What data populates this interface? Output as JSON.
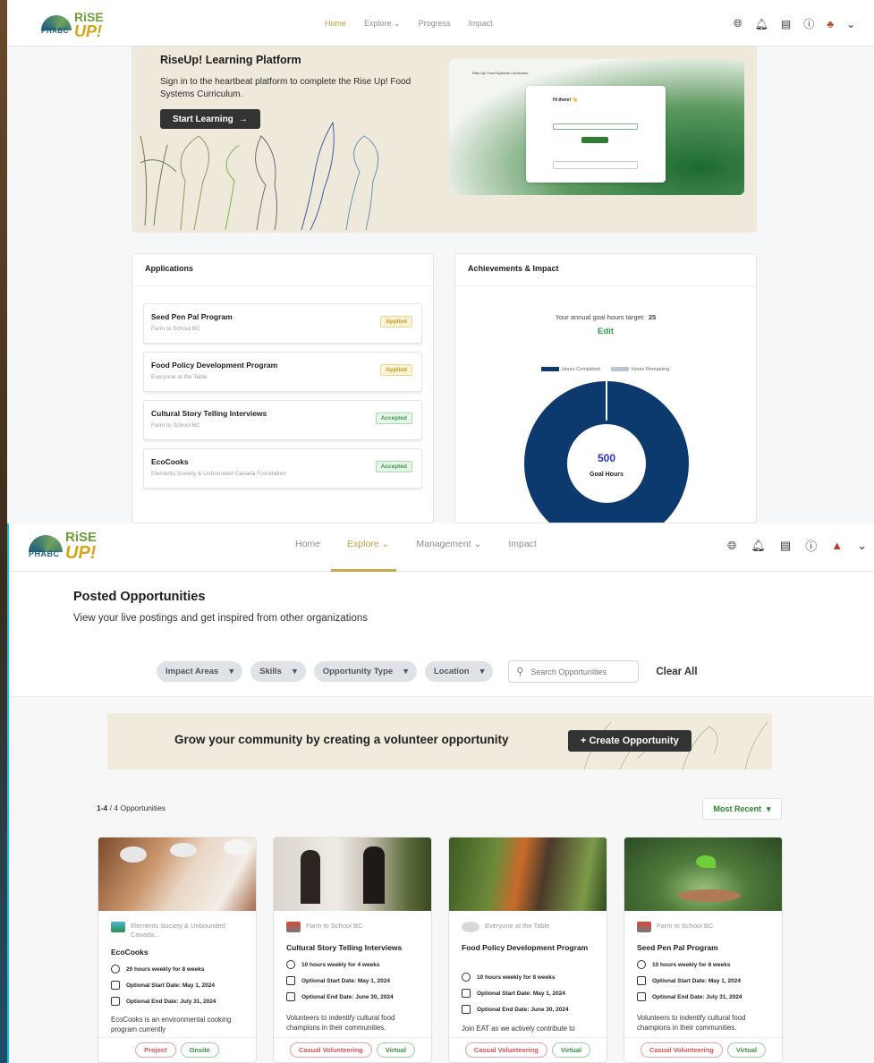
{
  "top": {
    "nav": {
      "brand_org": "PHABC",
      "brand_rise": "RiSE",
      "brand_up": "UP!",
      "menu": [
        "Home",
        "Explore",
        "Progress",
        "Impact"
      ]
    },
    "hero": {
      "title": "RiseUp! Learning Platform",
      "text": "Sign in to the heartbeat platform to complete the Rise Up! Food Systems Curriculum.",
      "button": "Start Learning",
      "preview_title": "Rise Up! Food Systems Curriculum",
      "preview_greeting": "Hi there! 👋"
    },
    "applications": {
      "title": "Applications",
      "items": [
        {
          "title": "Seed Pen Pal Program",
          "org": "Farm to School BC",
          "status": "Applied"
        },
        {
          "title": "Food Policy Development Program",
          "org": "Everyone at the Table",
          "status": "Applied"
        },
        {
          "title": "Cultural Story Telling Interviews",
          "org": "Farm to School BC",
          "status": "Accepted"
        },
        {
          "title": "EcoCooks",
          "org": "Elements Society & Unbounded Canada Foundation",
          "status": "Accepted"
        }
      ]
    },
    "achievements": {
      "title": "Achievements & Impact",
      "target_label": "Your annual goal hours target:",
      "target_value": "25",
      "edit": "Edit",
      "legend_completed": "Hours Completed",
      "legend_remaining": "Hours Remaining",
      "goal_value": "500",
      "goal_label": "Goal Hours",
      "completed_fraction": 0.0
    }
  },
  "bottom": {
    "nav": {
      "brand_org": "PHABC",
      "brand_rise": "RiSE",
      "brand_up": "UP!",
      "menu": [
        "Home",
        "Explore",
        "Management",
        "Impact"
      ]
    },
    "page_title": "Posted Opportunities",
    "page_subtitle": "View your live postings and get inspired from other organizations",
    "filters": [
      "Impact Areas",
      "Skills",
      "Opportunity Type",
      "Location"
    ],
    "search_placeholder": "Search Opportunities",
    "clear_all": "Clear All",
    "banner_text": "Grow your community by creating a volunteer opportunity",
    "banner_button": "+ Create Opportunity",
    "count_range": "1-4",
    "count_total": "/ 4 Opportunities",
    "sort": "Most Recent",
    "cards": [
      {
        "org": "Elements Society & Unbounded Canada...",
        "title": "EcoCooks",
        "hours": "20 hours weekly for 8 weeks",
        "start": "Optional Start Date: May 1, 2024",
        "end": "Optional End Date: July 31, 2024",
        "desc": "EcoCooks is an environmental cooking program currently",
        "tags": [
          "Project",
          "Onsite"
        ]
      },
      {
        "org": "Farm to School BC",
        "title": "Cultural Story Telling Interviews",
        "hours": "10 hours weekly for 4 weeks",
        "start": "Optional Start Date: May 1, 2024",
        "end": "Optional End Date: June 30, 2024",
        "desc": "Volunteers to indentify cultural food champions in their communities.",
        "tags": [
          "Casual Volunteering",
          "Virtual"
        ]
      },
      {
        "org": "Everyone at the Table",
        "title": "Food Policy Development Program",
        "hours": "10 hours weekly for 8 weeks",
        "start": "Optional Start Date: May 1, 2024",
        "end": "Optional End Date: June 30, 2024",
        "desc": "Join EAT as we actively contribute to",
        "tags": [
          "Casual Volunteering",
          "Virtual"
        ]
      },
      {
        "org": "Farm to School BC",
        "title": "Seed Pen Pal Program",
        "hours": "10 hours weekly for 8 weeks",
        "start": "Optional Start Date: May 1, 2024",
        "end": "Optional End Date: July 31, 2024",
        "desc": "Volunteers to indentify cultural food champions in their communities.",
        "tags": [
          "Casual Volunteering",
          "Virtual"
        ]
      }
    ]
  },
  "colors": {
    "navy": "#0c3a6e",
    "gray": "#b8c6d6",
    "green": "#2e7d32",
    "gold": "#c9a94c"
  }
}
